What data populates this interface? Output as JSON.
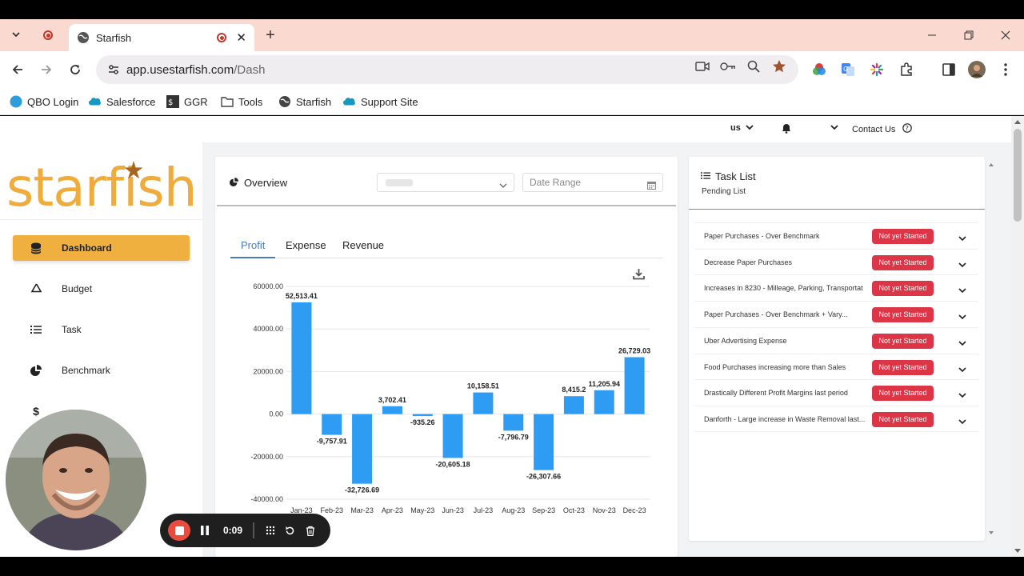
{
  "browser": {
    "tab_title": "Starfish",
    "url_host": "app.usestarfish.com",
    "url_path": "/Dash",
    "bookmarks": [
      "QBO Login",
      "Salesforce",
      "GGR",
      "Tools",
      "Starfish",
      "Support Site"
    ]
  },
  "app": {
    "logo_text": "starfish",
    "topnav": {
      "locale": "us",
      "contact": "Contact Us"
    },
    "sidebar": [
      {
        "label": "Dashboard",
        "icon": "database-icon",
        "active": true
      },
      {
        "label": "Budget",
        "icon": "recycle-icon"
      },
      {
        "label": "Task",
        "icon": "list-icon"
      },
      {
        "label": "Benchmark",
        "icon": "pie-chart-icon"
      },
      {
        "label": "",
        "icon": "dollar-icon"
      }
    ],
    "overview": {
      "title": "Overview",
      "date_placeholder": "Date Range",
      "tabs": [
        "Profit",
        "Expense",
        "Revenue"
      ],
      "active_tab": "Profit"
    },
    "task_list": {
      "title": "Task List",
      "subtitle": "Pending List",
      "tasks": [
        {
          "label": "Paper Purchases - Over Benchmark",
          "status": "Not yet Started"
        },
        {
          "label": "Decrease Paper Purchases",
          "status": "Not yet Started"
        },
        {
          "label": "Increases in 8230 - Milleage, Parking, Transportat",
          "status": "Not yet Started"
        },
        {
          "label": "Paper Purchases - Over Benchmark + Vary...",
          "status": "Not yet Started"
        },
        {
          "label": "Uber Advertising Expense",
          "status": "Not yet Started"
        },
        {
          "label": "Food Purchases increasing more than Sales",
          "status": "Not yet Started"
        },
        {
          "label": "Drastically Different Profit Margins last period",
          "status": "Not yet Started"
        },
        {
          "label": "Danforth - Large increase in Waste Removal last...",
          "status": "Not yet Started"
        }
      ],
      "status_color": "#dc3545"
    }
  },
  "recorder": {
    "time": "0:09"
  },
  "colors": {
    "accent": "#efb040",
    "bar": "#2e9cf2",
    "tab_active": "#4a7bb7"
  },
  "chart_data": {
    "type": "bar",
    "categories": [
      "Jan-23",
      "Feb-23",
      "Mar-23",
      "Apr-23",
      "May-23",
      "Jun-23",
      "Jul-23",
      "Aug-23",
      "Sep-23",
      "Oct-23",
      "Nov-23",
      "Dec-23"
    ],
    "values": [
      52513.41,
      -9757.91,
      -32726.69,
      3702.41,
      -935.26,
      -20605.18,
      10158.51,
      -7796.79,
      -26307.66,
      8415.2,
      11205.94,
      26729.03
    ],
    "value_labels": [
      "52,513.41",
      "-9,757.91",
      "-32,726.69",
      "3,702.41",
      "-935.26",
      "-20,605.18",
      "10,158.51",
      "-7,796.79",
      "-26,307.66",
      "8,415.2",
      "11,205.94",
      "26,729.03"
    ],
    "yticks": [
      "60000.00",
      "40000.00",
      "20000.00",
      "0.00",
      "-20000.00",
      "-40000.00"
    ],
    "ytick_values": [
      60000,
      40000,
      20000,
      0,
      -20000,
      -40000
    ],
    "ylim": [
      -40000,
      60000
    ],
    "grid": true
  }
}
